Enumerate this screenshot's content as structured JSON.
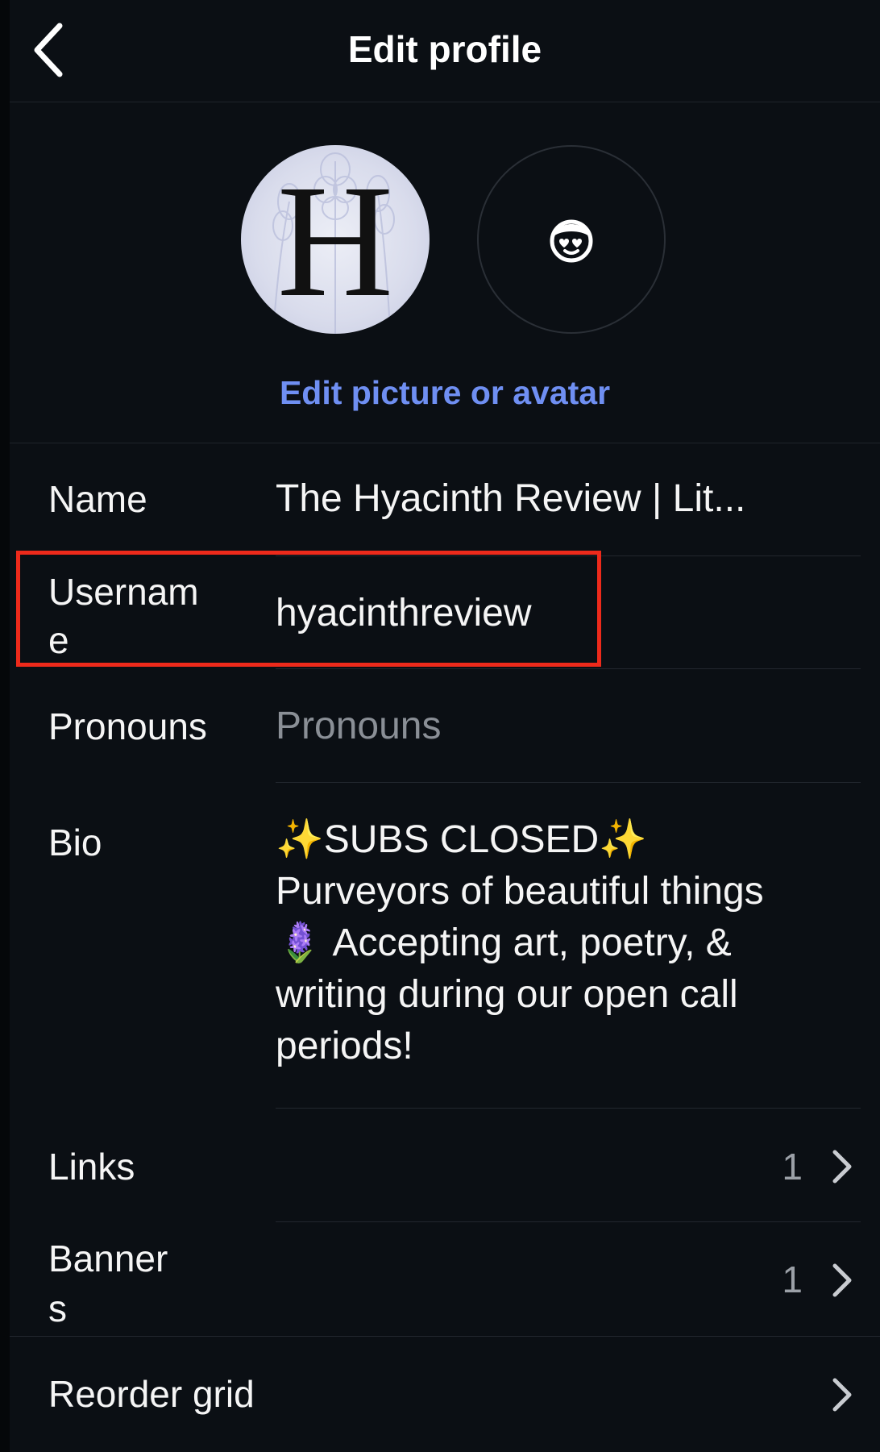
{
  "header": {
    "title": "Edit profile",
    "back_icon": "chevron-left-icon"
  },
  "avatar": {
    "profile_letter": "H",
    "alt_avatar_icon": "avatar-face-icon",
    "edit_link": "Edit picture or avatar"
  },
  "fields": {
    "name": {
      "label": "Name",
      "value": "The Hyacinth Review | Lit..."
    },
    "username": {
      "label": "Usernam\ne",
      "value": "hyacinthreview"
    },
    "pronouns": {
      "label": "Pronouns",
      "placeholder": "Pronouns"
    },
    "bio": {
      "label": "Bio",
      "value": "✨SUBS CLOSED✨\nPurveyors of beautiful things\n🪻 Accepting art, poetry, &\nwriting during our open call\nperiods!"
    },
    "links": {
      "label": "Links",
      "count": "1"
    },
    "banners": {
      "label": "Banner\ns",
      "count": "1"
    },
    "reorder": {
      "label": "Reorder grid"
    }
  },
  "colors": {
    "background": "#0b0f14",
    "accent_link": "#6f8ff2",
    "highlight": "#ee2a1b",
    "placeholder": "#8a8f96"
  }
}
